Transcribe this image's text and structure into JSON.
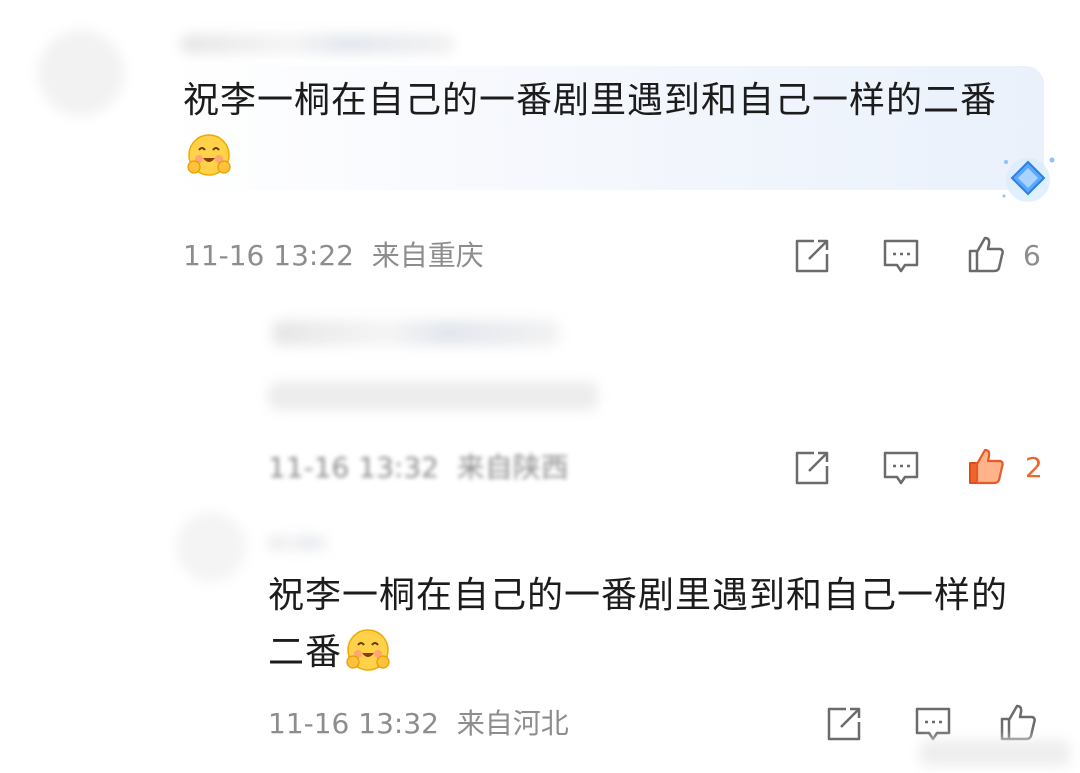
{
  "comments": [
    {
      "text": "祝李一桐在自己的一番剧里遇到和自己一样的二番",
      "emoji": "smiling-hug-emoji",
      "date": "11-16 13:22",
      "location": "来自重庆",
      "likes": "6",
      "liked": false
    },
    {
      "text": "",
      "date": "11-16 13:32",
      "location": "来自陕西",
      "likes": "2",
      "liked": true
    },
    {
      "text": "祝李一桐在自己的一番剧里遇到和自己一样的二番",
      "emoji": "smiling-hug-emoji",
      "date": "11-16 13:32",
      "location": "来自河北",
      "likes": "",
      "liked": false
    }
  ],
  "colors": {
    "meta_gray": "#8d8d8d",
    "icon_gray": "#6b6b6b",
    "liked_orange": "#f0652a",
    "bubble_blue": "#eaf1fb"
  }
}
